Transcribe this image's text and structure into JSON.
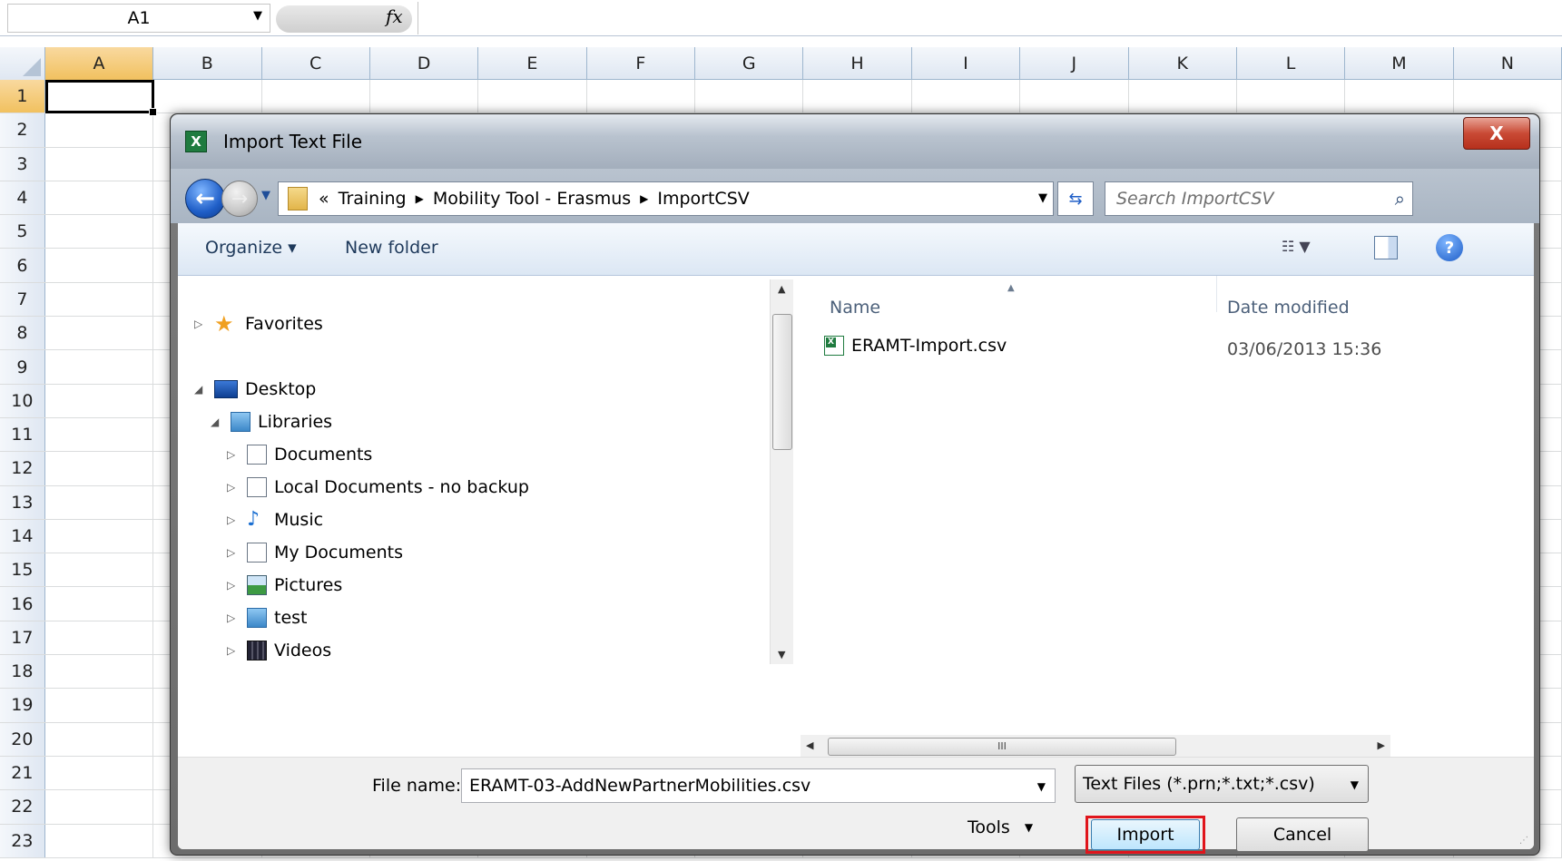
{
  "excel": {
    "name_box": "A1",
    "fx_label": "fx",
    "columns": [
      "A",
      "B",
      "C",
      "D",
      "E",
      "F",
      "G",
      "H",
      "I",
      "J",
      "K",
      "L",
      "M",
      "N"
    ],
    "rows": [
      "1",
      "2",
      "3",
      "4",
      "5",
      "6",
      "7",
      "8",
      "9",
      "10",
      "11",
      "12",
      "13",
      "14",
      "15",
      "16",
      "17",
      "18",
      "19",
      "20",
      "21",
      "22",
      "23"
    ]
  },
  "dialog": {
    "title": "Import Text File",
    "close_label": "X",
    "breadcrumb": [
      "«",
      "Training",
      "Mobility Tool - Erasmus",
      "ImportCSV"
    ],
    "search_placeholder": "Search ImportCSV",
    "toolbar": {
      "organize": "Organize ▾",
      "new_folder": "New folder"
    },
    "nav_tree": [
      {
        "label": "Favorites",
        "icon": "star-icon",
        "expander": "▷"
      },
      {
        "label": "Desktop",
        "icon": "desktop-icon",
        "expander": "◢"
      },
      {
        "label": "Libraries",
        "icon": "library-icon",
        "expander": "◢"
      },
      {
        "label": "Documents",
        "icon": "document-icon",
        "expander": "▷"
      },
      {
        "label": "Local Documents - no backup",
        "icon": "document-icon",
        "expander": "▷"
      },
      {
        "label": "Music",
        "icon": "music-icon",
        "expander": "▷"
      },
      {
        "label": "My Documents",
        "icon": "document-icon",
        "expander": "▷"
      },
      {
        "label": "Pictures",
        "icon": "pictures-icon",
        "expander": "▷"
      },
      {
        "label": "test",
        "icon": "library-icon",
        "expander": "▷"
      },
      {
        "label": "Videos",
        "icon": "videos-icon",
        "expander": "▷"
      }
    ],
    "file_columns": {
      "name": "Name",
      "date": "Date modified"
    },
    "files": [
      {
        "name": "ERAMT-Import.csv",
        "date": "03/06/2013 15:36",
        "icon": "csv-file-icon"
      }
    ],
    "hscroll_thumb": "III",
    "file_name_label": "File name:",
    "file_name_value": "ERAMT-03-AddNewPartnerMobilities.csv",
    "file_type": "Text Files (*.prn;*.txt;*.csv)",
    "tools_label": "Tools",
    "import_label": "Import",
    "cancel_label": "Cancel",
    "highlight_color": "#e0151c"
  }
}
